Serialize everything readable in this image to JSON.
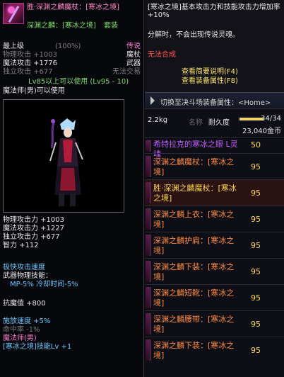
{
  "left": {
    "item_name": "胜·深渊之麟魔杖：[寒冰之境]",
    "set_name": "深渊之麟：[寒冰之境]",
    "set_label": "套装",
    "rarity": "(100%)",
    "level_label": "最上级",
    "type_label": "传说",
    "rows": [
      {
        "left": "物理攻击 +1003",
        "right": "魔杖"
      },
      {
        "left": "魔法攻击 +1776",
        "right": "武器"
      },
      {
        "left": "独立攻击 +677",
        "right": "无法交易"
      }
    ],
    "level_req": "Lv85以上可以使用 (Lv95 - 10)",
    "class_req": "魔法师(男)可以使用",
    "stats": [
      "物理攻击力 +1003",
      "魔法攻击力 +1227",
      "独立攻击力 +677",
      "智力 +112"
    ],
    "speed": "极快攻击速度",
    "skill_title": "武器物理技能：",
    "skill_detail": "MP-5% 冷却时间-5%",
    "resist": "抗魔值 +800",
    "cast_speed": "施放速度 +5%",
    "hit_rate": "命中率 -1%",
    "class_line": "魔法师(男)",
    "footer": "[寒冰之境]技能Lv +1"
  },
  "right": {
    "desc": "[寒冰之境]基本攻击力和技能攻击力增加率 +10%",
    "note": "分解时，不会出现传说灵魂。",
    "cannot": "无法合成",
    "view_intro": "查看简要说明(F4)",
    "view_attr": "查看装备属性(F8)",
    "switch": "切换至决斗场装备属性：<Home>",
    "weight": "2.2kg",
    "name_label": "名称",
    "durability_label": "耐久度",
    "durability": "34/34",
    "durability_ratio": 1.0,
    "price": "23,040金币",
    "items": [
      {
        "name": "希特拉克的寒冰之眼 L灵魂",
        "level": "50"
      },
      {
        "name": "深渊之麟魔杖：[寒冰之境]",
        "level": "95"
      },
      {
        "name": "胜·深渊之麟魔杖：[寒冰之境]",
        "level": "95"
      },
      {
        "name": "深渊之麟上衣：[寒冰之境]",
        "level": "95"
      },
      {
        "name": "深渊之麟护肩：[寒冰之境]",
        "level": "95"
      },
      {
        "name": "深渊之麟下装：[寒冰之境]",
        "level": "95"
      },
      {
        "name": "深渊之麟短靴：[寒冰之境]",
        "level": "95"
      },
      {
        "name": "深渊之麟腰带：[寒冰之境]",
        "level": "95"
      },
      {
        "name": "深渊之麟下装：[寒冰之境]",
        "level": "95"
      }
    ]
  }
}
